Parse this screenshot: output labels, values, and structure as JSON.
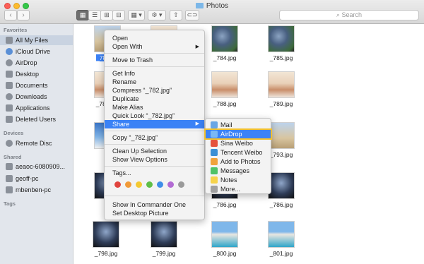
{
  "window": {
    "title": "Photos"
  },
  "toolbar": {
    "back": "‹",
    "forward": "›",
    "view_icon": "▦",
    "view_list": "☰",
    "view_columns": "⊞",
    "view_cover": "⊟",
    "arrange": "▦ ▾",
    "action": "⚙ ▾",
    "share": "⇧",
    "tags": "⊂⊃",
    "search_placeholder": "Search"
  },
  "sidebar": {
    "sections": {
      "favorites": "Favorites",
      "devices": "Devices",
      "shared": "Shared",
      "tags": "Tags"
    },
    "favorites": [
      {
        "label": "All My Files",
        "icon": "all-files-icon"
      },
      {
        "label": "iCloud Drive",
        "icon": "cloud-icon"
      },
      {
        "label": "AirDrop",
        "icon": "airdrop-icon"
      },
      {
        "label": "Desktop",
        "icon": "desktop-icon"
      },
      {
        "label": "Documents",
        "icon": "documents-icon"
      },
      {
        "label": "Downloads",
        "icon": "downloads-icon"
      },
      {
        "label": "Applications",
        "icon": "applications-icon"
      },
      {
        "label": "Deleted Users",
        "icon": "folder-icon"
      }
    ],
    "devices": [
      {
        "label": "Remote Disc",
        "icon": "disc-icon"
      }
    ],
    "shared": [
      {
        "label": "aeaoc-6080909...",
        "icon": "computer-icon"
      },
      {
        "label": "geoff-pc",
        "icon": "computer-icon"
      },
      {
        "label": "mbenben-pc",
        "icon": "computer-icon"
      }
    ]
  },
  "files": [
    {
      "name": "_782.jpg"
    },
    {
      "name": ""
    },
    {
      "name": "_784.jpg"
    },
    {
      "name": "_785.jpg"
    },
    {
      "name": "_786.jpg"
    },
    {
      "name": "_788.jpg"
    },
    {
      "name": "_789.jpg"
    },
    {
      "name": "_793.jpg"
    },
    {
      "name": "_798.jpg"
    },
    {
      "name": "_799.jpg"
    },
    {
      "name": "_800.jpg"
    },
    {
      "name": "_801.jpg"
    }
  ],
  "context_menu": {
    "open": "Open",
    "open_with": "Open With",
    "move_to_trash": "Move to Trash",
    "get_info": "Get Info",
    "rename": "Rename",
    "compress": "Compress “_782.jpg”",
    "duplicate": "Duplicate",
    "make_alias": "Make Alias",
    "quick_look": "Quick Look “_782.jpg”",
    "share": "Share",
    "copy": "Copy “_782.jpg”",
    "clean_up": "Clean Up Selection",
    "view_options": "Show View Options",
    "tags": "Tags...",
    "commander": "Show In Commander One",
    "desktop_picture": "Set Desktop Picture",
    "arrow": "▶"
  },
  "tag_colors": [
    "#e0443e",
    "#f19a38",
    "#f4c932",
    "#5fbe47",
    "#3f8ee8",
    "#b26bd3",
    "#9a9a9a"
  ],
  "share_menu": [
    {
      "label": "Mail",
      "icon": "mail-icon",
      "color": "#6aa6e6"
    },
    {
      "label": "AirDrop",
      "icon": "airdrop-icon",
      "color": "#7ab8f5"
    },
    {
      "label": "Sina Weibo",
      "icon": "weibo-icon",
      "color": "#e5533c"
    },
    {
      "label": "Tencent Weibo",
      "icon": "tencent-weibo-icon",
      "color": "#3b8fd5"
    },
    {
      "label": "Add to Photos",
      "icon": "photos-icon",
      "color": "#f0a23b"
    },
    {
      "label": "Messages",
      "icon": "messages-icon",
      "color": "#4fc267"
    },
    {
      "label": "Notes",
      "icon": "notes-icon",
      "color": "#f6d34a"
    },
    {
      "label": "More...",
      "icon": "more-icon",
      "color": "#a0a0a0"
    }
  ]
}
